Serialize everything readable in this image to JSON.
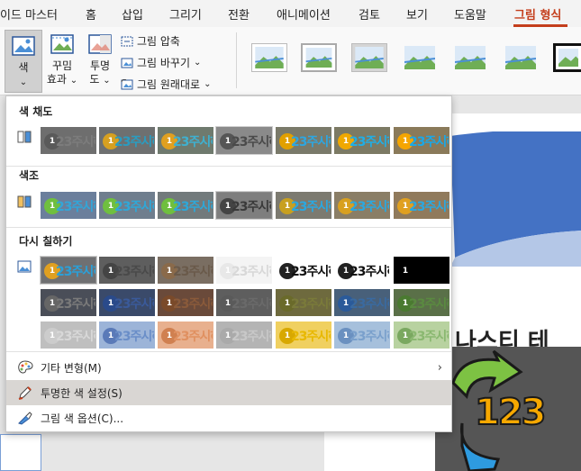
{
  "tabs": {
    "design": "이드 마스터",
    "home": "홈",
    "insert": "삽입",
    "draw": "그리기",
    "transitions": "전환",
    "animations": "애니메이션",
    "review": "검토",
    "view": "보기",
    "help": "도움말",
    "picture_format": "그림 형식"
  },
  "ribbon": {
    "color_label": "색",
    "artistic_effects_l1": "꾸밈",
    "artistic_effects_l2": "효과",
    "transparency_l1": "투명",
    "transparency_l2": "도",
    "compress_label": "그림 압축",
    "change_label": "그림 바꾸기",
    "reset_label": "그림 원래대로",
    "dropdown_glyph": "⌄"
  },
  "menu": {
    "saturation_title": "색 채도",
    "tone_title": "색조",
    "recolor_title": "다시 칠하기",
    "swatch_text": "23주시하",
    "swatch_number": "1",
    "more_variations": "기타 변형(M)",
    "set_transparent": "투명한 색 설정(S)",
    "picture_color_options": "그림 색 옵션(C)...",
    "submenu_arrow": "›"
  },
  "slide": {
    "partial_title": "나스티 테",
    "pic_text": "123"
  },
  "colors": {
    "accent": "#c43e1c",
    "slide_blue": "#4472c4"
  }
}
